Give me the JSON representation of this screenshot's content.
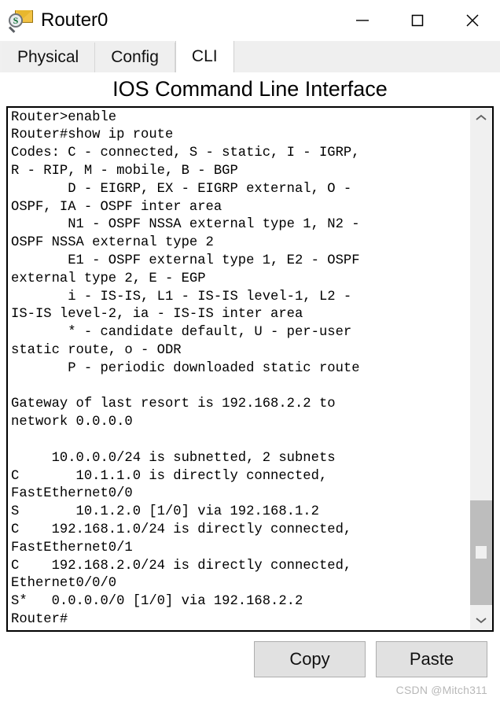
{
  "window": {
    "title": "Router0",
    "icon": "router-envelope-magnifier-icon",
    "controls": {
      "minimize": "minimize-icon",
      "maximize": "maximize-icon",
      "close": "close-icon"
    }
  },
  "tabs": [
    {
      "label": "Physical",
      "active": false
    },
    {
      "label": "Config",
      "active": false
    },
    {
      "label": "CLI",
      "active": true
    }
  ],
  "heading": "IOS Command Line Interface",
  "terminal": {
    "lines": [
      "Router>enable",
      "Router#show ip route",
      "Codes: C - connected, S - static, I - IGRP,",
      "R - RIP, M - mobile, B - BGP",
      "       D - EIGRP, EX - EIGRP external, O -",
      "OSPF, IA - OSPF inter area",
      "       N1 - OSPF NSSA external type 1, N2 -",
      "OSPF NSSA external type 2",
      "       E1 - OSPF external type 1, E2 - OSPF",
      "external type 2, E - EGP",
      "       i - IS-IS, L1 - IS-IS level-1, L2 -",
      "IS-IS level-2, ia - IS-IS inter area",
      "       * - candidate default, U - per-user",
      "static route, o - ODR",
      "       P - periodic downloaded static route",
      "",
      "Gateway of last resort is 192.168.2.2 to",
      "network 0.0.0.0",
      "",
      "     10.0.0.0/24 is subnetted, 2 subnets",
      "C       10.1.1.0 is directly connected,",
      "FastEthernet0/0",
      "S       10.1.2.0 [1/0] via 192.168.1.2",
      "C    192.168.1.0/24 is directly connected,",
      "FastEthernet0/1",
      "C    192.168.2.0/24 is directly connected,",
      "Ethernet0/0/0",
      "S*   0.0.0.0/0 [1/0] via 192.168.2.2",
      "Router#"
    ],
    "scrollbar": {
      "up_arrow": "chevron-up-icon",
      "down_arrow": "chevron-down-icon"
    }
  },
  "footer": {
    "copy_label": "Copy",
    "paste_label": "Paste",
    "watermark": "CSDN @Mitch311"
  },
  "colors": {
    "tab_active_bg": "#ffffff",
    "tab_inactive_bg": "#efefef",
    "button_bg": "#e1e1e1",
    "terminal_border": "#000000",
    "scrollbar_thumb": "#bdbdbd",
    "watermark": "#b8b8b8"
  }
}
